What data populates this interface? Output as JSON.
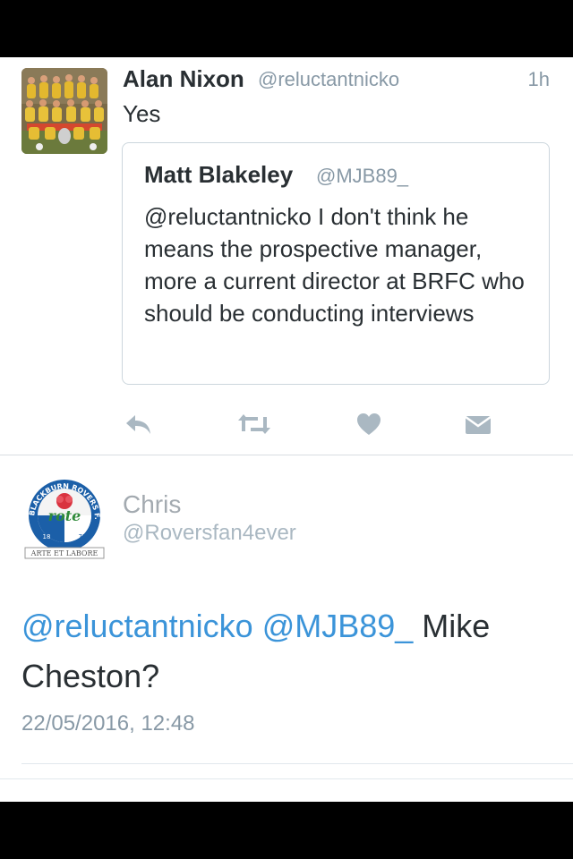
{
  "tweet_main": {
    "author_name": "Alan Nixon",
    "author_handle": "@reluctantnicko",
    "time": "1h",
    "text": "Yes",
    "quoted": {
      "author_name": "Matt Blakeley",
      "author_handle": "@MJB89_",
      "text": "@reluctantnicko I don't think he means the prospective manager, more a current director at BRFC who should be conducting interviews"
    },
    "actions": [
      "reply-icon",
      "retweet-icon",
      "like-icon",
      "message-icon"
    ]
  },
  "tweet_detail": {
    "author_name": "Chris",
    "author_handle": "@Roversfan4ever",
    "mention_1": "@reluctantnicko",
    "mention_2": "@MJB89_",
    "text_rest": " Mike Cheston?",
    "date": "22/05/2016, 12:48",
    "avatar_badge": {
      "arc_text": "BLACKBURN ROVERS F.C.",
      "center_text": "rote",
      "year_left": "18",
      "year_right": "75",
      "motto": "ARTE ET LABORE"
    }
  },
  "colors": {
    "link": "#3b94d9",
    "muted": "#8899a6",
    "text": "#292f33",
    "border": "#ccd6dd"
  }
}
